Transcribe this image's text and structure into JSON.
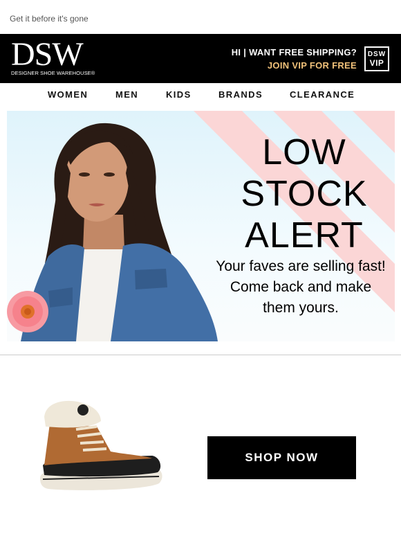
{
  "preheader": {
    "text": "Get it before it's gone"
  },
  "header": {
    "logo_text": "DSW",
    "logo_subtitle": "DESIGNER SHOE WAREHOUSE®",
    "promo_line1": "HI  |  WANT FREE SHIPPING?",
    "promo_line2": "JOIN VIP FOR FREE",
    "vip_badge_top": "DSW",
    "vip_badge_bottom": "VIP",
    "colors": {
      "background": "#000000",
      "promo_accent": "#f2c27a"
    }
  },
  "nav": {
    "items": [
      {
        "label": "WOMEN"
      },
      {
        "label": "MEN"
      },
      {
        "label": "KIDS"
      },
      {
        "label": "BRANDS"
      },
      {
        "label": "CLEARANCE"
      }
    ]
  },
  "hero": {
    "title_line1": "LOW",
    "title_line2": "STOCK",
    "title_line3": "ALERT",
    "subtitle_line1": "Your faves are selling fast!",
    "subtitle_line2": "Come back and make",
    "subtitle_line3": "them yours.",
    "colors": {
      "stripes": "#fbd6d6",
      "sky": "#dff3fb"
    }
  },
  "product": {
    "image_icon": "boot-image",
    "cta_label": "SHOP NOW"
  }
}
